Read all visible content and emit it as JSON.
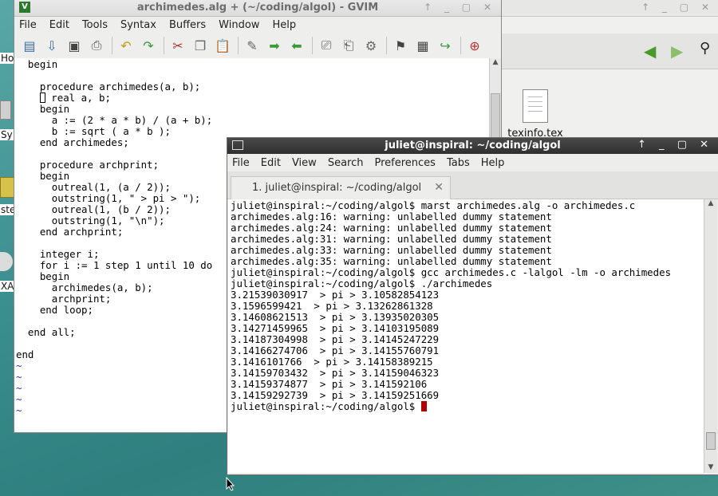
{
  "desktop": {
    "labels": [
      "Hon",
      "Sy",
      "steb",
      "XA"
    ]
  },
  "file_manager": {
    "file_name": "texinfo.tex"
  },
  "gvim": {
    "title": "archimedes.alg + (~/coding/algol) - GVIM",
    "menu": [
      "File",
      "Edit",
      "Tools",
      "Syntax",
      "Buffers",
      "Window",
      "Help"
    ],
    "lines": [
      "  begin",
      "",
      "    procedure archimedes(a, b);",
      "    ",
      "    begin",
      "      a := (2 * a * b) / (a + b);",
      "      b := sqrt ( a * b );",
      "    end archimedes;",
      "",
      "    procedure archprint;",
      "    begin",
      "      outreal(1, (a / 2));",
      "      outstring(1, \" > pi > \");",
      "      outreal(1, (b / 2));",
      "      outstring(1, \"\\n\");",
      "    end archprint;",
      "",
      "    integer i;",
      "    for i := 1 step 1 until 10 do",
      "    begin",
      "      archimedes(a, b);",
      "      archprint;",
      "    end loop;",
      "",
      "  end all;",
      "",
      "end",
      "~",
      "~",
      "~",
      "~",
      "~"
    ],
    "cursor_line_text": " real a, b;"
  },
  "terminal": {
    "title": "juliet@inspiral: ~/coding/algol",
    "menu": [
      "File",
      "Edit",
      "View",
      "Search",
      "Preferences",
      "Tabs",
      "Help"
    ],
    "tab_label": "1. juliet@inspiral: ~/coding/algol",
    "lines": [
      "juliet@inspiral:~/coding/algol$ marst archimedes.alg -o archimedes.c",
      "archimedes.alg:16: warning: unlabelled dummy statement",
      "archimedes.alg:24: warning: unlabelled dummy statement",
      "archimedes.alg:31: warning: unlabelled dummy statement",
      "archimedes.alg:33: warning: unlabelled dummy statement",
      "archimedes.alg:35: warning: unlabelled dummy statement",
      "juliet@inspiral:~/coding/algol$ gcc archimedes.c -lalgol -lm -o archimedes",
      "juliet@inspiral:~/coding/algol$ ./archimedes",
      "3.21539030917  > pi > 3.10582854123",
      "3.1596599421  > pi > 3.13262861328",
      "3.14608621513  > pi > 3.13935020305",
      "3.14271459965  > pi > 3.14103195089",
      "3.14187304998  > pi > 3.14145247229",
      "3.14166274706  > pi > 3.14155760791",
      "3.1416101766  > pi > 3.14158389215",
      "3.14159703432  > pi > 3.14159046323",
      "3.14159374877  > pi > 3.141592106",
      "3.14159292739  > pi > 3.14159251669"
    ],
    "prompt": "juliet@inspiral:~/coding/algol$ "
  }
}
